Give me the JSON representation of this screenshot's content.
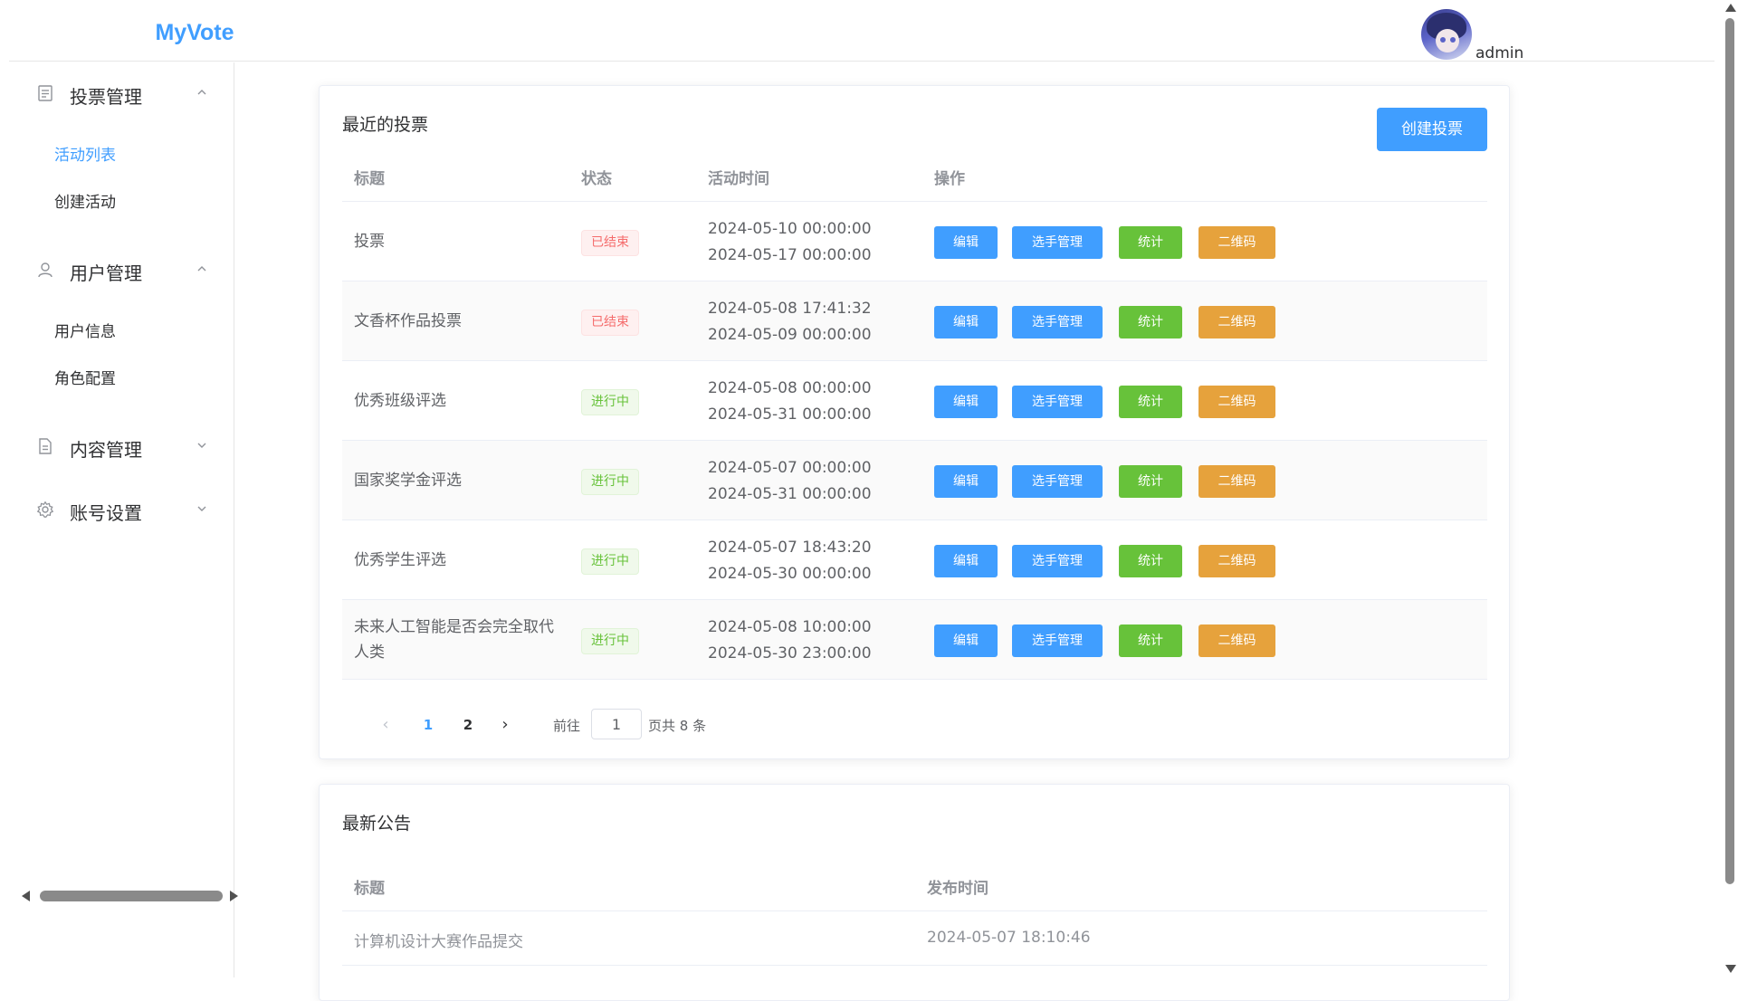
{
  "app": {
    "logo": "MyVote"
  },
  "user": {
    "name": "admin"
  },
  "sidebar": {
    "groups": [
      {
        "label": "投票管理",
        "icon": "document-list-icon",
        "expanded": true,
        "items": [
          {
            "label": "活动列表",
            "active": true
          },
          {
            "label": "创建活动",
            "active": false
          }
        ]
      },
      {
        "label": "用户管理",
        "icon": "user-icon",
        "expanded": true,
        "items": [
          {
            "label": "用户信息",
            "active": false
          },
          {
            "label": "角色配置",
            "active": false
          }
        ]
      },
      {
        "label": "内容管理",
        "icon": "document-icon",
        "expanded": false,
        "items": []
      },
      {
        "label": "账号设置",
        "icon": "gear-icon",
        "expanded": false,
        "items": []
      }
    ]
  },
  "votes": {
    "title": "最近的投票",
    "create_label": "创建投票",
    "columns": {
      "title": "标题",
      "status": "状态",
      "time": "活动时间",
      "actions": "操作"
    },
    "actions": {
      "edit": "编辑",
      "players": "选手管理",
      "stats": "统计",
      "qrcode": "二维码"
    },
    "rows": [
      {
        "title": "投票",
        "status": "已结束",
        "start": "2024-05-10 00:00:00",
        "end": "2024-05-17 00:00:00"
      },
      {
        "title": "文香杯作品投票",
        "status": "已结束",
        "start": "2024-05-08 17:41:32",
        "end": "2024-05-09 00:00:00"
      },
      {
        "title": "优秀班级评选",
        "status": "进行中",
        "start": "2024-05-08 00:00:00",
        "end": "2024-05-31 00:00:00"
      },
      {
        "title": "国家奖学金评选",
        "status": "进行中",
        "start": "2024-05-07 00:00:00",
        "end": "2024-05-31 00:00:00"
      },
      {
        "title": "优秀学生评选",
        "status": "进行中",
        "start": "2024-05-07 18:43:20",
        "end": "2024-05-30 00:00:00"
      },
      {
        "title": "未来人工智能是否会完全取代人类",
        "status": "进行中",
        "start": "2024-05-08 10:00:00",
        "end": "2024-05-30 23:00:00"
      }
    ],
    "pagination": {
      "pages": [
        "1",
        "2"
      ],
      "current": "1",
      "goto_label": "前往",
      "page_value": "1",
      "total_label": "页共 8 条"
    }
  },
  "announcements": {
    "title": "最新公告",
    "columns": {
      "title": "标题",
      "published": "发布时间"
    },
    "rows": [
      {
        "title": "计算机设计大赛作品提交",
        "published": "2024-05-07 18:10:46"
      }
    ]
  },
  "colors": {
    "primary": "#409eff",
    "success": "#67c23a",
    "warning": "#e6a23c",
    "danger": "#f56c6c"
  }
}
